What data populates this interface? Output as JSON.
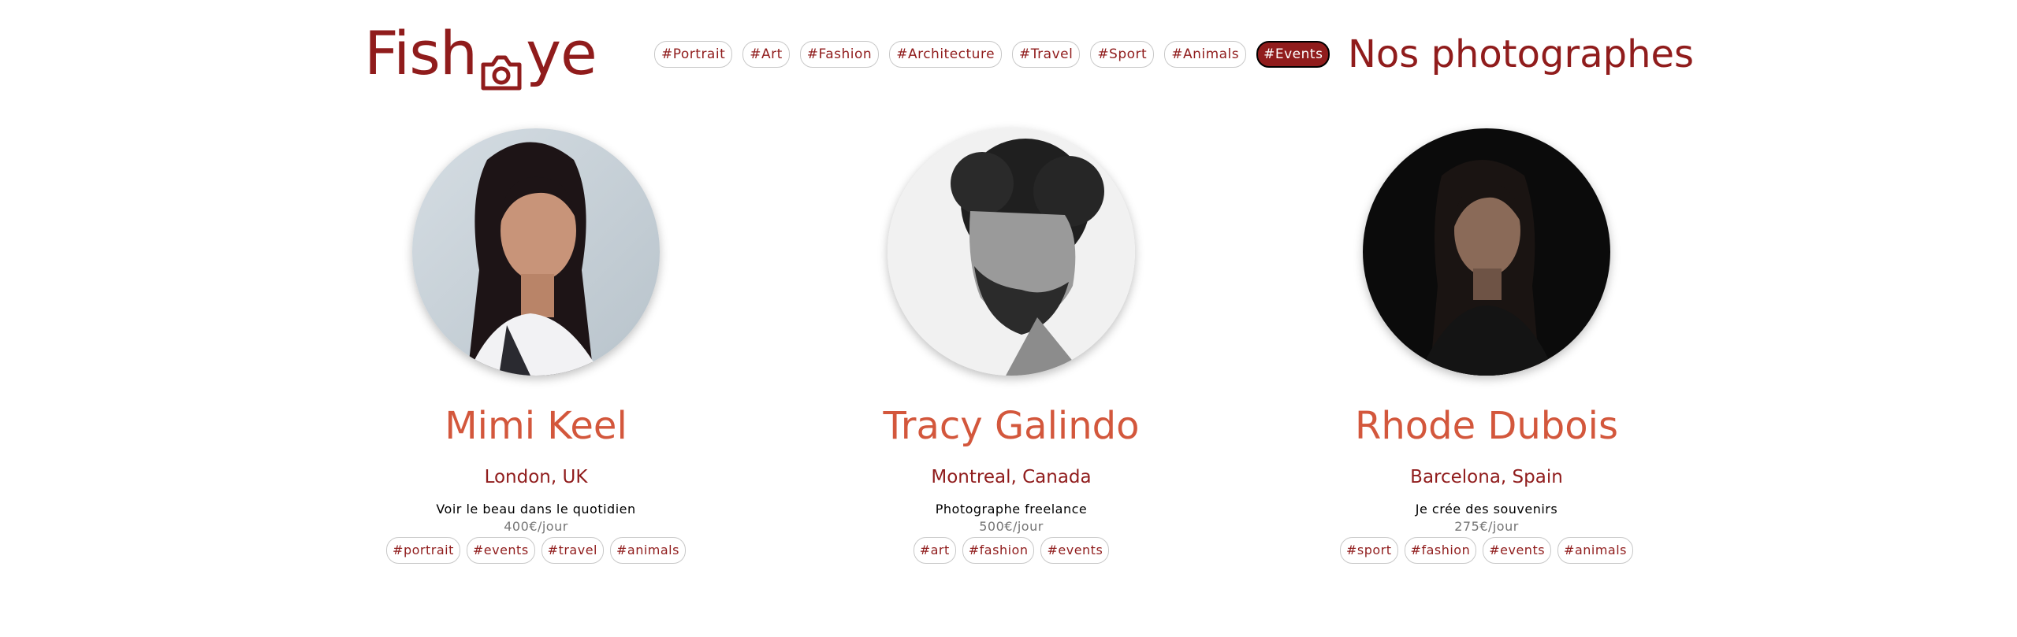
{
  "brand": {
    "logo_left": "Fish",
    "logo_right": "ye",
    "logo_icon": "camera-icon"
  },
  "nav": {
    "tags": [
      "#Portrait",
      "#Art",
      "#Fashion",
      "#Architecture",
      "#Travel",
      "#Sport",
      "#Animals",
      "#Events"
    ],
    "active": "#Events"
  },
  "page_title": "Nos photographes",
  "photographers": [
    {
      "name": "Mimi Keel",
      "location": "London, UK",
      "tagline": "Voir le beau dans le quotidien",
      "price": "400€/jour",
      "tags": [
        "#portrait",
        "#events",
        "#travel",
        "#animals"
      ]
    },
    {
      "name": "Tracy Galindo",
      "location": "Montreal, Canada",
      "tagline": "Photographe freelance",
      "price": "500€/jour",
      "tags": [
        "#art",
        "#fashion",
        "#events"
      ]
    },
    {
      "name": "Rhode Dubois",
      "location": "Barcelona, Spain",
      "tagline": "Je crée des souvenirs",
      "price": "275€/jour",
      "tags": [
        "#sport",
        "#fashion",
        "#events",
        "#animals"
      ]
    }
  ],
  "colors": {
    "primary": "#901c1c",
    "accent": "#d3573c",
    "muted": "#757575"
  }
}
